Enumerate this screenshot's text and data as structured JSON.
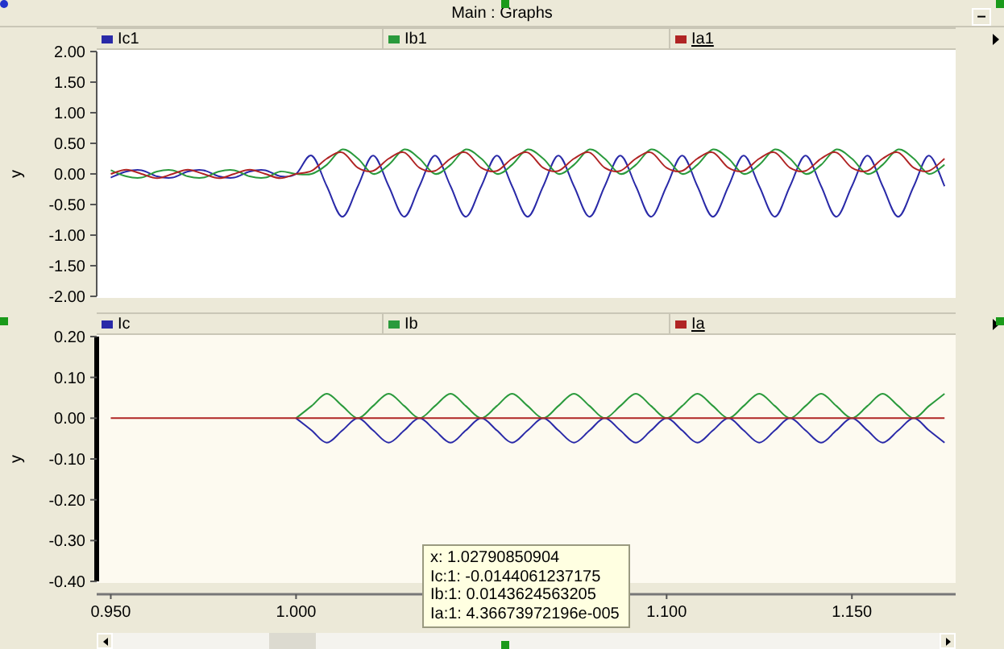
{
  "window": {
    "title": "Main : Graphs",
    "minimize_button": "–"
  },
  "panels": [
    {
      "legend": [
        {
          "selected": false
        },
        {
          "selected": false
        },
        {
          "selected": true
        }
      ],
      "chart_data": {
        "type": "line",
        "ylabel": "y",
        "xlim": [
          0.9462,
          1.178
        ],
        "ylim": [
          -2,
          2
        ],
        "yticks": [
          {
            "value": 2,
            "label": "2.00"
          },
          {
            "value": 1.5,
            "label": "1.50"
          },
          {
            "value": 1,
            "label": "1.00"
          },
          {
            "value": 0.5,
            "label": "0.50"
          },
          {
            "value": 0,
            "label": "0.00"
          },
          {
            "value": -0.5,
            "label": "-0.50"
          },
          {
            "value": -1,
            "label": "-1.00"
          },
          {
            "value": -1.5,
            "label": "-1.50"
          },
          {
            "value": -2,
            "label": "-2.00"
          }
        ],
        "x": [
          0.95,
          0.9542,
          0.9583,
          0.9625,
          0.9667,
          0.9708,
          0.975,
          0.9792,
          0.9833,
          0.9875,
          0.9917,
          0.9958,
          1.0,
          1.0042,
          1.0083,
          1.0125,
          1.0167,
          1.0208,
          1.025,
          1.0292,
          1.0333,
          1.0375,
          1.0417,
          1.0458,
          1.05,
          1.0542,
          1.0583,
          1.0625,
          1.0667,
          1.0708,
          1.075,
          1.0792,
          1.0833,
          1.0875,
          1.0917,
          1.0958,
          1.1,
          1.1042,
          1.1083,
          1.1125,
          1.1167,
          1.1208,
          1.125,
          1.1292,
          1.1333,
          1.1375,
          1.1417,
          1.1458,
          1.15,
          1.1542,
          1.1583,
          1.1625,
          1.1667,
          1.1708,
          1.175
        ],
        "series": [
          {
            "name": "Ic1",
            "color": "#2a2aa8",
            "values": [
              -0.06,
              0.04,
              0.06,
              -0.04,
              -0.06,
              0.04,
              0.06,
              -0.04,
              -0.06,
              0.04,
              0.06,
              -0.04,
              0,
              0.3,
              -0.2,
              -0.7,
              -0.2,
              0.3,
              -0.2,
              -0.7,
              -0.2,
              0.3,
              -0.2,
              -0.7,
              -0.2,
              0.3,
              -0.2,
              -0.7,
              -0.2,
              0.3,
              -0.2,
              -0.7,
              -0.2,
              0.3,
              -0.2,
              -0.7,
              -0.2,
              0.3,
              -0.2,
              -0.7,
              -0.2,
              0.3,
              -0.2,
              -0.7,
              -0.2,
              0.3,
              -0.2,
              -0.7,
              -0.2,
              0.3,
              -0.2,
              -0.7,
              -0.2,
              0.3,
              -0.2
            ]
          },
          {
            "name": "Ib1",
            "color": "#2a9a3c",
            "values": [
              0.06,
              -0.04,
              -0.06,
              0.04,
              0.06,
              -0.04,
              -0.06,
              0.04,
              0.06,
              -0.04,
              -0.06,
              0.04,
              0,
              0.0,
              0.15,
              0.4,
              0.25,
              0.0,
              0.15,
              0.4,
              0.25,
              0.0,
              0.15,
              0.4,
              0.25,
              0.0,
              0.15,
              0.4,
              0.25,
              0.0,
              0.15,
              0.4,
              0.25,
              0.0,
              0.15,
              0.4,
              0.25,
              0.0,
              0.15,
              0.4,
              0.25,
              0.0,
              0.15,
              0.4,
              0.25,
              0.0,
              0.15,
              0.4,
              0.25,
              0.0,
              0.15,
              0.4,
              0.25,
              0.0,
              0.15
            ]
          },
          {
            "name": "Ia1",
            "color": "#b02424",
            "values": [
              0,
              0.07,
              0,
              -0.07,
              0,
              0.07,
              0,
              -0.07,
              0,
              0.07,
              0,
              -0.07,
              0,
              0.05,
              0.25,
              0.35,
              0.1,
              0.05,
              0.25,
              0.35,
              0.1,
              0.05,
              0.25,
              0.35,
              0.1,
              0.05,
              0.25,
              0.35,
              0.1,
              0.05,
              0.25,
              0.35,
              0.1,
              0.05,
              0.25,
              0.35,
              0.1,
              0.05,
              0.25,
              0.35,
              0.1,
              0.05,
              0.25,
              0.35,
              0.1,
              0.05,
              0.25,
              0.35,
              0.1,
              0.05,
              0.25,
              0.35,
              0.1,
              0.05,
              0.25
            ]
          }
        ]
      }
    },
    {
      "legend": [
        {
          "selected": false
        },
        {
          "selected": false
        },
        {
          "selected": true
        }
      ],
      "chart_data": {
        "type": "line",
        "ylabel": "y",
        "xlim": [
          0.9462,
          1.178
        ],
        "ylim": [
          -0.4,
          0.2
        ],
        "yticks": [
          {
            "value": 0.2,
            "label": "0.20"
          },
          {
            "value": 0.1,
            "label": "0.10"
          },
          {
            "value": 0,
            "label": "0.00"
          },
          {
            "value": -0.1,
            "label": "-0.10"
          },
          {
            "value": -0.2,
            "label": "-0.20"
          },
          {
            "value": -0.3,
            "label": "-0.30"
          },
          {
            "value": -0.4,
            "label": "-0.40"
          }
        ],
        "xticks": [
          {
            "value": 0.95,
            "label": "0.950"
          },
          {
            "value": 1.0,
            "label": "1.000"
          },
          {
            "value": 1.1,
            "label": "1.100"
          },
          {
            "value": 1.15,
            "label": "1.150"
          }
        ],
        "x": [
          0.95,
          0.9542,
          0.9583,
          0.9625,
          0.9667,
          0.9708,
          0.975,
          0.9792,
          0.9833,
          0.9875,
          0.9917,
          0.9958,
          1.0,
          1.0042,
          1.0083,
          1.0125,
          1.0167,
          1.0208,
          1.025,
          1.0292,
          1.0333,
          1.0375,
          1.0417,
          1.0458,
          1.05,
          1.0542,
          1.0583,
          1.0625,
          1.0667,
          1.0708,
          1.075,
          1.0792,
          1.0833,
          1.0875,
          1.0917,
          1.0958,
          1.1,
          1.1042,
          1.1083,
          1.1125,
          1.1167,
          1.1208,
          1.125,
          1.1292,
          1.1333,
          1.1375,
          1.1417,
          1.1458,
          1.15,
          1.1542,
          1.1583,
          1.1625,
          1.1667,
          1.1708,
          1.175
        ],
        "series": [
          {
            "name": "Ic",
            "color": "#2a2aa8",
            "values": [
              null,
              null,
              null,
              null,
              null,
              null,
              null,
              null,
              null,
              null,
              null,
              null,
              0,
              -0.03,
              -0.06,
              -0.03,
              0,
              -0.03,
              -0.06,
              -0.03,
              0,
              -0.03,
              -0.06,
              -0.03,
              0,
              -0.03,
              -0.06,
              -0.03,
              0,
              -0.03,
              -0.06,
              -0.03,
              0,
              -0.03,
              -0.06,
              -0.03,
              0,
              -0.03,
              -0.06,
              -0.03,
              0,
              -0.03,
              -0.06,
              -0.03,
              0,
              -0.03,
              -0.06,
              -0.03,
              0,
              -0.03,
              -0.06,
              -0.03,
              0,
              -0.03,
              -0.06
            ]
          },
          {
            "name": "Ib",
            "color": "#2a9a3c",
            "values": [
              null,
              null,
              null,
              null,
              null,
              null,
              null,
              null,
              null,
              null,
              null,
              null,
              0,
              0.03,
              0.06,
              0.03,
              0,
              0.03,
              0.06,
              0.03,
              0,
              0.03,
              0.06,
              0.03,
              0,
              0.03,
              0.06,
              0.03,
              0,
              0.03,
              0.06,
              0.03,
              0,
              0.03,
              0.06,
              0.03,
              0,
              0.03,
              0.06,
              0.03,
              0,
              0.03,
              0.06,
              0.03,
              0,
              0.03,
              0.06,
              0.03,
              0,
              0.03,
              0.06,
              0.03,
              0,
              0.03,
              0.06
            ]
          },
          {
            "name": "Ia",
            "color": "#b02424",
            "values": [
              0,
              0,
              0,
              0,
              0,
              0,
              0,
              0,
              0,
              0,
              0,
              0,
              0,
              0,
              0,
              0,
              0,
              0,
              0,
              0,
              0,
              0,
              0,
              0,
              0,
              0,
              0,
              0,
              0,
              0,
              0,
              0,
              0,
              0,
              0,
              0,
              0,
              0,
              0,
              0,
              0,
              0,
              0,
              0,
              0,
              0,
              0,
              0,
              0,
              0,
              0,
              0,
              0,
              0,
              0
            ]
          }
        ]
      }
    }
  ],
  "tooltip": [
    "x: 1.02790850904",
    "Ic:1: -0.0144061237175",
    "Ib:1: 0.0143624563205",
    "Ia:1: 4.36673972196e-005"
  ]
}
